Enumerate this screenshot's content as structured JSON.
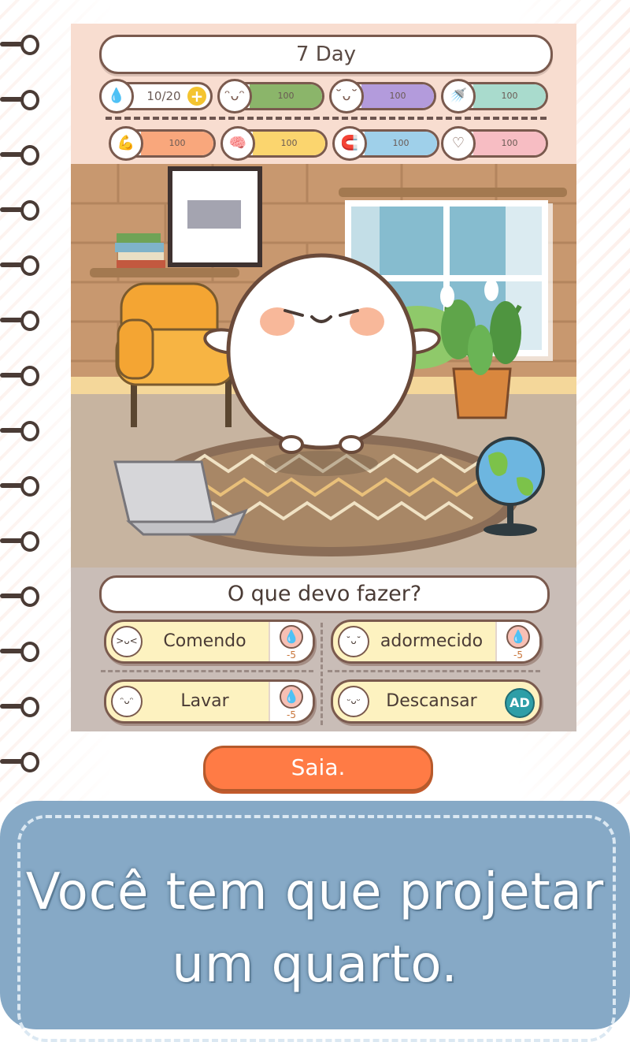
{
  "header": {
    "day_label": "7 Day"
  },
  "stats_row1": [
    {
      "icon": "water-drop-icon",
      "value": "10/20",
      "color": "#ffffff",
      "fill": 0
    },
    {
      "icon": "food-face-icon",
      "value": "100",
      "color": "#8bb56a",
      "fill": 1
    },
    {
      "icon": "sleep-face-icon",
      "value": "100",
      "color": "#b39bdc",
      "fill": 1
    },
    {
      "icon": "shower-icon",
      "value": "100",
      "color": "#a9dbcd",
      "fill": 1
    }
  ],
  "stats_row2": [
    {
      "icon": "strength-arm-icon",
      "value": "100",
      "color": "#f9a77c",
      "fill": 1
    },
    {
      "icon": "brain-icon",
      "value": "100",
      "color": "#fbd56e",
      "fill": 1
    },
    {
      "icon": "magnet-icon",
      "value": "100",
      "color": "#9fd0ea",
      "fill": 1
    },
    {
      "icon": "heart-icon",
      "value": "100",
      "color": "#f7bdc3",
      "fill": 1
    }
  ],
  "question": "O que devo fazer?",
  "choices": [
    {
      "label": "Comendo",
      "cost": "-5"
    },
    {
      "label": "adormecido",
      "cost": "-5"
    },
    {
      "label": "Lavar",
      "cost": "-5"
    },
    {
      "label": "Descansar",
      "badge": "AD"
    }
  ],
  "exit_label": "Saia.",
  "banner_line1": "Você tem que projetar",
  "banner_line2": "um quarto.",
  "colors": {
    "accent": "#ff7b45",
    "banner": "#86a9c6",
    "ad": "#2e9ea7"
  }
}
